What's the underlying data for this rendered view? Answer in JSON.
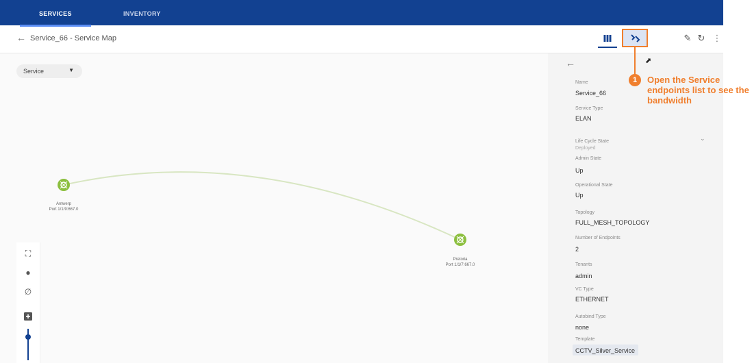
{
  "nav": {
    "tabs": [
      {
        "label": "SERVICES",
        "active": true
      },
      {
        "label": "INVENTORY",
        "active": false
      }
    ]
  },
  "header": {
    "title": "Service_66 - Service Map",
    "icons": [
      "map-view-icon",
      "endpoints-list-icon",
      "edit-pencil-icon",
      "refresh-icon",
      "more-options-icon"
    ]
  },
  "map": {
    "view_select": "Service",
    "nodes": [
      {
        "name": "Antwerp",
        "port": "Port 1/1/9:667.0"
      },
      {
        "name": "Pretoria",
        "port": "Port 1/1/7:667.0"
      }
    ],
    "tools": [
      "fit-screen-icon",
      "node-icon",
      "link-icon",
      "zoom-in-icon",
      "zoom-slider"
    ]
  },
  "panel": {
    "fields": [
      {
        "label": "Name",
        "value": "Service_66"
      },
      {
        "label": "Service Type",
        "value": "ELAN"
      },
      {
        "label": "Life Cycle State",
        "value": "Deployed"
      },
      {
        "label": "Admin State",
        "value": "Up"
      },
      {
        "label": "Operational State",
        "value": "Up"
      },
      {
        "label": "Topology",
        "value": "FULL_MESH_TOPOLOGY"
      },
      {
        "label": "Number of Endpoints",
        "value": "2"
      },
      {
        "label": "Tenants",
        "value": "admin"
      },
      {
        "label": "VC Type",
        "value": "ETHERNET"
      },
      {
        "label": "Autobind Type",
        "value": "none"
      },
      {
        "label": "Template",
        "value": "CCTV_Silver_Service"
      }
    ]
  },
  "callout": {
    "number": "1",
    "text": "Open the Service endpoints list to see the bandwidth"
  },
  "colors": {
    "nav_bg": "#124191",
    "accent": "#f07f2e",
    "node": "#8cbf3f"
  }
}
